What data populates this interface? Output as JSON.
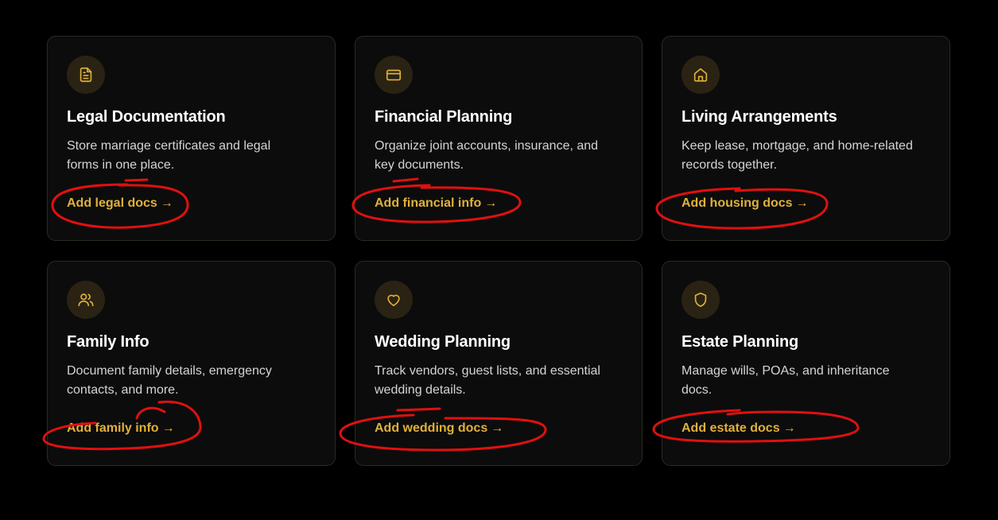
{
  "colors": {
    "accent": "#e0b13a",
    "card_background": "#0c0c0c",
    "icon_background": "#2a2313",
    "annotation": "#e01010"
  },
  "cards": [
    {
      "icon": "document-icon",
      "title": "Legal Documentation",
      "description": "Store marriage certificates and legal forms in one place.",
      "action_label": "Add legal docs",
      "arrow": "→"
    },
    {
      "icon": "credit-card-icon",
      "title": "Financial Planning",
      "description": "Organize joint accounts, insurance, and key documents.",
      "action_label": "Add financial info",
      "arrow": "→"
    },
    {
      "icon": "home-icon",
      "title": "Living Arrangements",
      "description": "Keep lease, mortgage, and home-related records together.",
      "action_label": "Add housing docs",
      "arrow": "→"
    },
    {
      "icon": "users-icon",
      "title": "Family Info",
      "description": "Document family details, emergency contacts, and more.",
      "action_label": "Add family info",
      "arrow": "→"
    },
    {
      "icon": "heart-icon",
      "title": "Wedding Planning",
      "description": "Track vendors, guest lists, and essential wedding details.",
      "action_label": "Add wedding docs",
      "arrow": "→"
    },
    {
      "icon": "shield-icon",
      "title": "Estate Planning",
      "description": "Manage wills, POAs, and inheritance docs.",
      "action_label": "Add estate docs",
      "arrow": "→"
    }
  ]
}
